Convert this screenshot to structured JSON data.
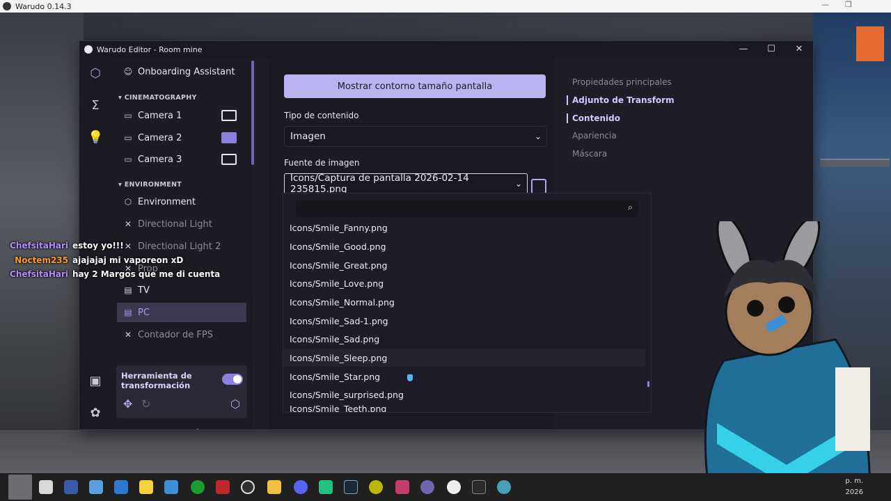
{
  "app_title": "Warudo 0.14.3",
  "window": {
    "title": "Warudo Editor - Room mine",
    "controls": {
      "minimize": "—",
      "maximize": "☐",
      "close": "✕"
    }
  },
  "left_panel": {
    "onboarding": "Onboarding Assistant",
    "sections": {
      "cinematography": "CINEMATOGRAPHY",
      "environment": "ENVIRONMENT"
    },
    "cameras": [
      "Camera 1",
      "Camera 2",
      "Camera 3"
    ],
    "environment_items": [
      "Environment",
      "Directional Light",
      "Directional Light 2",
      "Prop",
      "TV",
      "PC",
      "Contador de FPS"
    ],
    "tool": {
      "label": "Herramienta de transformación",
      "enabled": true
    },
    "bottom_tools": "+ − ⧉ ✎ ⊞ ···"
  },
  "center": {
    "primary_button": "Mostrar contorno tamaño pantalla",
    "content_type_label": "Tipo de contenido",
    "content_type_value": "Imagen",
    "image_source_label": "Fuente de imagen",
    "image_source_value": "Icons/Captura de pantalla 2026-02-14 235815.png",
    "dropdown_options": [
      "Icons/Smile_Fanny.png",
      "Icons/Smile_Good.png",
      "Icons/Smile_Great.png",
      "Icons/Smile_Love.png",
      "Icons/Smile_Normal.png",
      "Icons/Smile_Sad-1.png",
      "Icons/Smile_Sad.png",
      "Icons/Smile_Sleep.png",
      "Icons/Smile_Star.png",
      "Icons/Smile_surprised.png",
      "Icons/Smile_Teeth.png"
    ],
    "hovered_option_index": 7
  },
  "right_nav": {
    "items": [
      "Propiedades principales",
      "Adjunto de Transform",
      "Contenido",
      "Apariencia",
      "Máscara"
    ],
    "active": [
      "Adjunto de Transform",
      "Contenido"
    ]
  },
  "chat": [
    {
      "user": "ChefsitaHari",
      "color": "#b58cff",
      "msg": "estoy yo!!!"
    },
    {
      "user": "Noctem235",
      "color": "#ff9a2e",
      "msg": "ajajajaj mi vaporeon xD"
    },
    {
      "user": "ChefsitaHari",
      "color": "#b58cff",
      "msg": "hay 2 Margos que me di cuenta"
    }
  ],
  "taskbar": {
    "clock_line1": "p. m.",
    "clock_line2": "2026",
    "icons": [
      "task-view-icon",
      "bird-app-icon",
      "photos-icon",
      "store-icon",
      "sticky-notes-icon",
      "gallery-icon",
      "xbox-icon",
      "voicemeeter-icon",
      "obs-icon",
      "folder-icon",
      "discord-icon",
      "app-icon",
      "steam-icon",
      "osu-icon",
      "paint-icon",
      "warudo-icon",
      "warudo-active-icon",
      "terminal-icon",
      "warudo-2-icon"
    ]
  }
}
